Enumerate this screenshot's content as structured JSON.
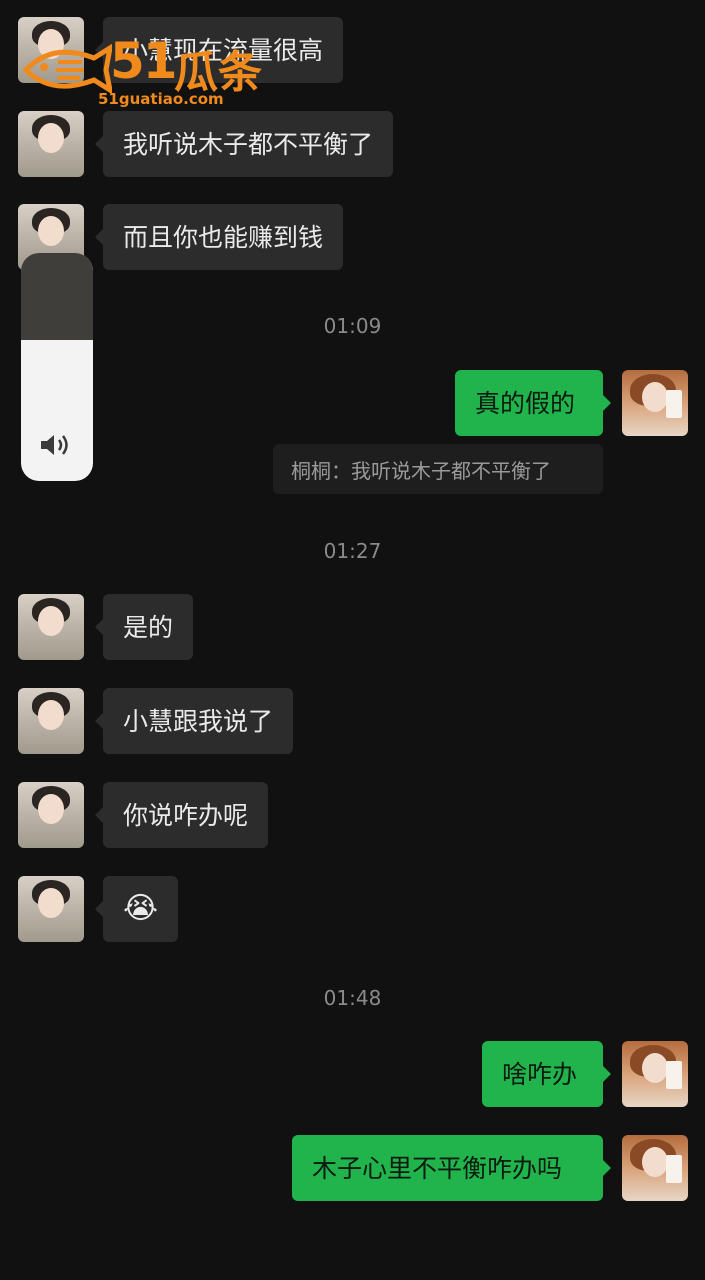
{
  "messages": {
    "m1": "小慧现在流量很高",
    "m2": "我听说木子都不平衡了",
    "m3": "而且你也能赚到钱",
    "m4": "真的假的",
    "m5": "是的",
    "m6": "小慧跟我说了",
    "m7": "你说咋办呢",
    "m8": "😭",
    "m9": "啥咋办",
    "m10": "木子心里不平衡咋办吗"
  },
  "quote": "桐桐：我听说木子都不平衡了",
  "timestamps": {
    "t1": "01:09",
    "t2": "01:27",
    "t3": "01:48"
  },
  "watermark": {
    "brand": "51瓜条",
    "number": "51",
    "chinese": "瓜条",
    "url": "51guatiao.com"
  },
  "volume": {
    "level_fraction": 0.62,
    "icon": "speaker-icon"
  },
  "colors": {
    "background": "#111111",
    "incoming_bubble": "#2c2c2c",
    "outgoing_bubble": "#22b44c",
    "watermark": "#f08a1c"
  }
}
